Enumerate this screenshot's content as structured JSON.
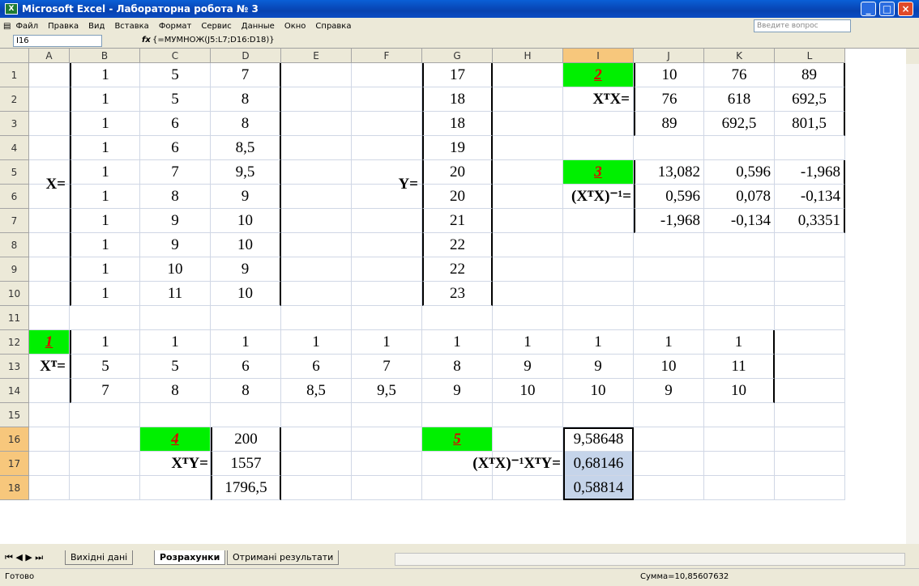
{
  "window": {
    "title": "Microsoft Excel - Лабораторна робота № 3"
  },
  "menu": [
    "Файл",
    "Правка",
    "Вид",
    "Вставка",
    "Формат",
    "Сервис",
    "Данные",
    "Окно",
    "Справка"
  ],
  "ask": "Введите вопрос",
  "formula_bar": {
    "cell": "I16",
    "fx": "fx",
    "formula": "{=МУМНОЖ(J5:L7;D16:D18)}"
  },
  "columns": [
    "A",
    "B",
    "C",
    "D",
    "E",
    "F",
    "G",
    "H",
    "I",
    "J",
    "K",
    "L"
  ],
  "rows": [
    "1",
    "2",
    "3",
    "4",
    "5",
    "6",
    "7",
    "8",
    "9",
    "10",
    "11",
    "12",
    "13",
    "14",
    "15",
    "16",
    "17",
    "18"
  ],
  "labels": {
    "X": "X=",
    "Y": "Y=",
    "m1": "1",
    "m2": "2",
    "m3": "3",
    "m4": "4",
    "m5": "5",
    "XT": "Xᵀ=",
    "XTX": "XᵀX=",
    "inv": "(XᵀX)⁻¹=",
    "XTY": "XᵀY=",
    "res": "(XᵀX)⁻¹XᵀY="
  },
  "X": [
    [
      "1",
      "5",
      "7"
    ],
    [
      "1",
      "5",
      "8"
    ],
    [
      "1",
      "6",
      "8"
    ],
    [
      "1",
      "6",
      "8,5"
    ],
    [
      "1",
      "7",
      "9,5"
    ],
    [
      "1",
      "8",
      "9"
    ],
    [
      "1",
      "9",
      "10"
    ],
    [
      "1",
      "9",
      "10"
    ],
    [
      "1",
      "10",
      "9"
    ],
    [
      "1",
      "11",
      "10"
    ]
  ],
  "Y": [
    "17",
    "18",
    "18",
    "19",
    "20",
    "20",
    "21",
    "22",
    "22",
    "23"
  ],
  "XTX": [
    [
      "10",
      "76",
      "89"
    ],
    [
      "76",
      "618",
      "692,5"
    ],
    [
      "89",
      "692,5",
      "801,5"
    ]
  ],
  "INV": [
    [
      "13,082",
      "0,596",
      "-1,968"
    ],
    [
      "0,596",
      "0,078",
      "-0,134"
    ],
    [
      "-1,968",
      "-0,134",
      "0,3351"
    ]
  ],
  "XT": [
    [
      "1",
      "1",
      "1",
      "1",
      "1",
      "1",
      "1",
      "1",
      "1",
      "1"
    ],
    [
      "5",
      "5",
      "6",
      "6",
      "7",
      "8",
      "9",
      "9",
      "10",
      "11"
    ],
    [
      "7",
      "8",
      "8",
      "8,5",
      "9,5",
      "9",
      "10",
      "10",
      "9",
      "10"
    ]
  ],
  "XTYv": [
    "200",
    "1557",
    "1796,5"
  ],
  "B": [
    "9,58648",
    "0,68146",
    "0,58814"
  ],
  "sheets": [
    "Вихідні дані",
    "Розрахунки",
    "Отримані результати"
  ],
  "status": {
    "ready": "Готово",
    "sum": "Сумма=10,85607632"
  }
}
